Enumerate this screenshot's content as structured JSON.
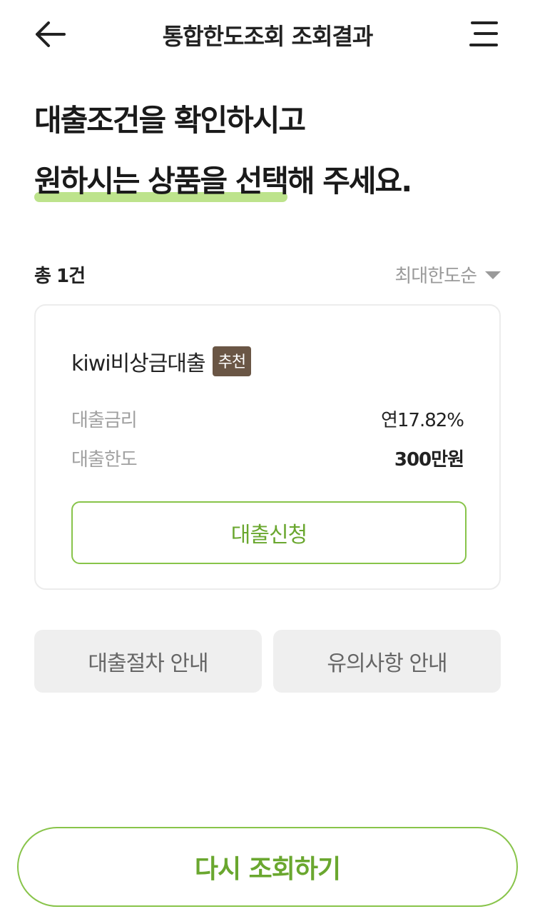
{
  "header": {
    "title": "통합한도조회 조회결과",
    "back_icon": "arrow-left-icon",
    "menu_icon": "hamburger-menu-icon"
  },
  "headline": {
    "line1": "대출조건을 확인하시고",
    "line2_highlight": "원하시는 상품을 선택",
    "line2_rest": "해 주세요.",
    "highlight_color": "#bde38c"
  },
  "list": {
    "total": "총 1건",
    "sort_label": "최대한도순"
  },
  "product": {
    "name": "kiwi비상금대출",
    "badge": "추천",
    "rate_label": "대출금리",
    "rate_value": "연17.82%",
    "limit_label": "대출한도",
    "limit_value": "300만원",
    "apply_label": "대출신청"
  },
  "info_buttons": {
    "procedure": "대출절차 안내",
    "notice": "유의사항 안내"
  },
  "footer": {
    "retry_label": "다시 조회하기"
  },
  "colors": {
    "accent": "#88c44a",
    "accent_text": "#6aa72f",
    "badge_bg": "#6a5645"
  }
}
